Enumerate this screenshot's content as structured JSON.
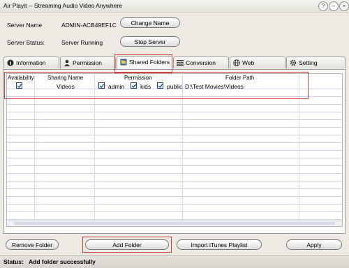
{
  "window": {
    "title": "Air Playit -- Streaming Audio Video Anywhere"
  },
  "server": {
    "name_label": "Server Name",
    "name_value": "ADMIN-ACB49EF1C",
    "change_name_button": "Change Name",
    "status_label": "Server Status:",
    "status_value": "Server Running",
    "stop_button": "Stop Server"
  },
  "tabs": [
    {
      "label": "Information",
      "icon": "info-icon"
    },
    {
      "label": "Permission",
      "icon": "user-icon"
    },
    {
      "label": "Shared Folders",
      "icon": "shared-folder-icon",
      "active": true
    },
    {
      "label": "Conversion",
      "icon": "list-icon"
    },
    {
      "label": "Web",
      "icon": "globe-icon"
    },
    {
      "label": "Setting",
      "icon": "gear-icon"
    }
  ],
  "table": {
    "columns": [
      "Availability",
      "Sharing Name",
      "Permission",
      "Folder Path"
    ],
    "rows": [
      {
        "available": true,
        "sharing_name": "Videos",
        "permissions": [
          {
            "name": "admin",
            "checked": true
          },
          {
            "name": "kids",
            "checked": true
          },
          {
            "name": "public",
            "checked": true
          }
        ],
        "folder_path": "D:\\Test Movies\\Videos"
      }
    ]
  },
  "buttons": {
    "remove_folder": "Remove Folder",
    "add_folder": "Add Folder",
    "import_itunes": "Import iTunes Playlist",
    "apply": "Apply"
  },
  "status": {
    "label": "Status:",
    "message": "Add folder successfully"
  },
  "colors": {
    "highlight": "#d6403c",
    "checkbox_border": "#1c3f7a",
    "check": "#1f5fb8"
  }
}
